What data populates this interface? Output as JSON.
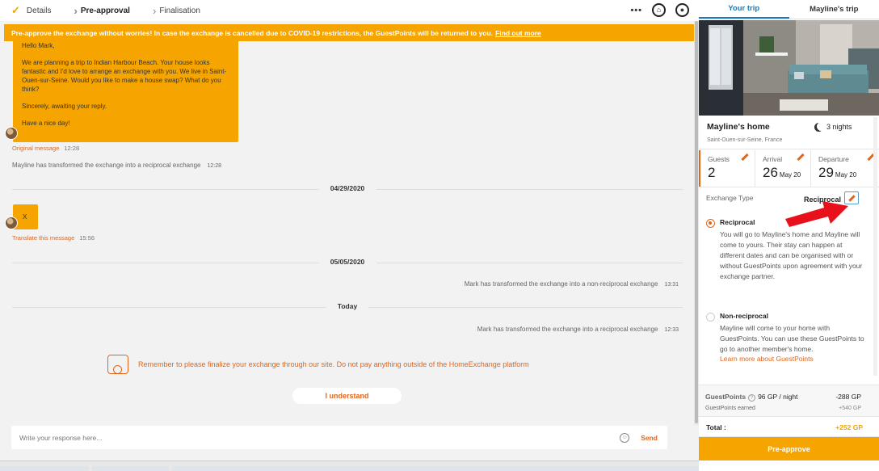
{
  "steps": [
    {
      "label": "Details",
      "state": "done"
    },
    {
      "label": "Pre-approval",
      "state": "active"
    },
    {
      "label": "Finalisation",
      "state": "pending"
    }
  ],
  "topbar": {
    "more_icon": "more-dots-icon",
    "home_icon": "home-icon",
    "user_icon": "user-icon"
  },
  "banner": {
    "text": "Pre-approve the exchange without worries! In case the exchange is cancelled due to COVID-19 restrictions, the GuestPoints will be returned to you.",
    "link": "Find out more"
  },
  "chat": {
    "message1": {
      "greeting": "Hello Mark,",
      "p1": "We are planning a trip to Indian Harbour Beach. Your house looks fantastic and I'd love to arrange an exchange with you. We live in Saint-Ouen-sur-Seine. Would you like to make a house swap? What do you think?",
      "p2": "Sincerely, awaiting your reply.",
      "p3": "Have a nice day!",
      "meta_label": "Original message",
      "time": "12:28"
    },
    "system1": {
      "text": "Mayline has transformed the exchange into a reciprocal exchange",
      "time": "12:28"
    },
    "date1": "04/29/2020",
    "message2": {
      "text": "X",
      "meta_label": "Translate this message",
      "time": "15:56"
    },
    "date2": "05/05/2020",
    "system2": {
      "text": "Mark has transformed the exchange into a non-reciprocal exchange",
      "time": "13:31"
    },
    "date3": "Today",
    "system3": {
      "text": "Mark has transformed the exchange into a reciprocal exchange",
      "time": "12:33"
    },
    "reminder": "Remember to please finalize your exchange through our site. Do not pay anything outside of the HomeExchange platform",
    "understand_label": "I understand",
    "input_placeholder": "Write your response here...",
    "send_label": "Send"
  },
  "panel": {
    "tabs": [
      "Your trip",
      "Mayline's trip"
    ],
    "active_tab": 0,
    "home_name": "Mayline's home",
    "location": "Saint-Ouen-sur-Seine, France",
    "nights": "3 nights",
    "guests_label": "Guests",
    "guests_value": "2",
    "arrival_label": "Arrival",
    "arrival_day": "26",
    "arrival_month": "May 20",
    "departure_label": "Departure",
    "departure_day": "29",
    "departure_month": "May 20",
    "exchange_type_label": "Exchange Type",
    "exchange_type_value": "Reciprocal",
    "options": [
      {
        "title": "Reciprocal",
        "selected": true,
        "desc": "You will go to Mayline's home and Mayline will come to yours. Their stay can happen at different dates and can be organised with or without GuestPoints upon agreement with your exchange partner."
      },
      {
        "title": "Non-reciprocal",
        "selected": false,
        "desc": "Mayline will come to your home with GuestPoints. You can use these GuestPoints to go to another member's home.",
        "link": "Learn more about GuestPoints"
      }
    ],
    "guestpoints_label": "GuestPoints",
    "guestpoints_rate": "96 GP / night",
    "guestpoints_value": "-288 GP",
    "guestpoints_earned_label": "GuestPoints earned",
    "guestpoints_earned_value": "+540 GP",
    "total_label": "Total :",
    "total_value": "+252 GP",
    "preapprove_label": "Pre-approve"
  },
  "colors": {
    "brand_orange": "#f6a500",
    "accent_orange": "#e0661c",
    "tab_blue": "#1a7bb8",
    "arrow_red": "#e8101a"
  }
}
